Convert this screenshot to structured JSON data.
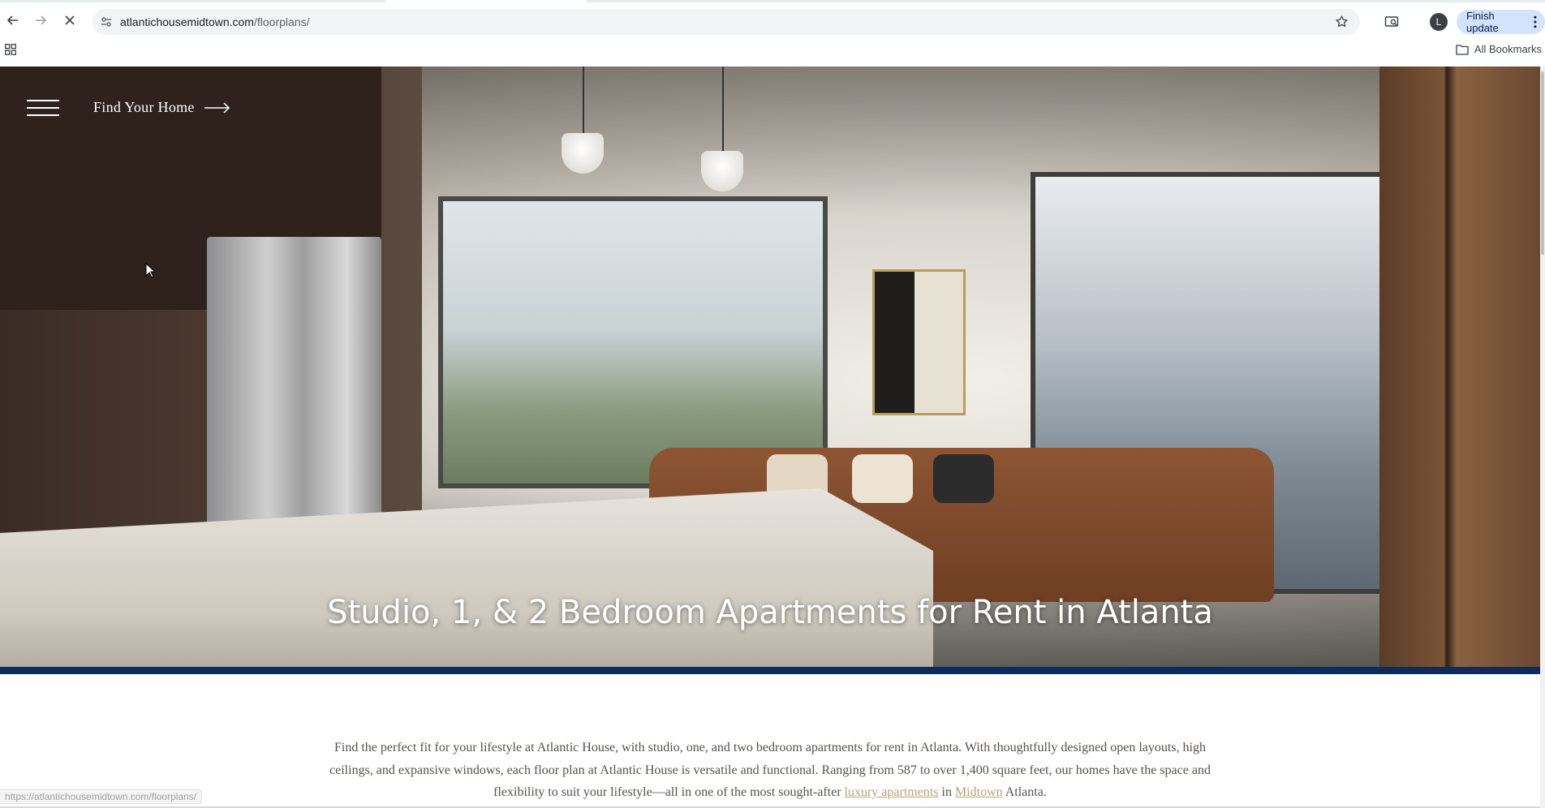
{
  "browser": {
    "url_host": "atlantichousemidtown.com",
    "url_path": "/floorplans/",
    "profile_initial": "L",
    "finish_update_label": "Finish update",
    "all_bookmarks_label": "All Bookmarks",
    "status_url": "https://atlantichousemidtown.com/floorplans/",
    "icons": {
      "back": "back-arrow-icon",
      "forward": "forward-arrow-icon",
      "stop": "stop-loading-icon",
      "site_info": "tune-icon",
      "bookmark": "star-icon",
      "cast": "cast-search-icon",
      "menu": "kebab-menu-icon",
      "apps": "apps-grid-icon",
      "folder": "folder-icon"
    }
  },
  "hero": {
    "nav_label": "Find Your Home",
    "title": "Studio, 1, & 2 Bedroom Apartments for Rent in Atlanta",
    "accent_bar_color": "#0d2a63"
  },
  "intro": {
    "text_before": "Find the perfect fit for your lifestyle at Atlantic House, with studio, one, and two bedroom apartments for rent in Atlanta. With thoughtfully designed open layouts, high ceilings, and expansive windows, each floor plan at Atlantic House is versatile and functional. Ranging from 587 to over 1,400 square feet, our homes have the space and flexibility to suit your lifestyle—all in one of the most sought-after ",
    "link1": "luxury apartments",
    "text_mid": " in ",
    "link2": "Midtown",
    "text_after": " Atlanta.",
    "link_color": "#b7a274"
  }
}
